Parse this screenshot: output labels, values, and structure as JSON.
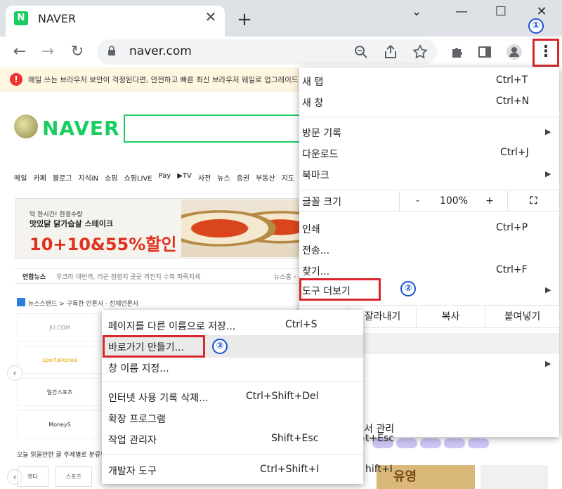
{
  "tab": {
    "title": "NAVER",
    "favicon_letter": "N",
    "close": "✕",
    "new_tab": "+"
  },
  "window": {
    "chevron": "⌄",
    "minimize": "—",
    "maximize": "☐",
    "close": "✕"
  },
  "toolbar": {
    "back": "←",
    "forward": "→",
    "reload": "↻",
    "url": "naver.com"
  },
  "page": {
    "banner": "매일 쓰는 브라우저 보안이 걱정된다면, 안전하고 빠른 최신 브라우저 웨일로 업그레이드 하세요",
    "banner_icon": "!",
    "logo": "NAVER",
    "nav_links": [
      "메일",
      "카페",
      "블로그",
      "지식iN",
      "쇼핑",
      "쇼핑LIVE",
      "Pay",
      "▶TV",
      "사전",
      "뉴스",
      "증권",
      "부동산",
      "지도"
    ],
    "ad": {
      "sub": "딱 한시간! 한정수량",
      "title": "맛있닭 닭가슴살 스테이크",
      "promo": "10+10&55%할인"
    },
    "news": {
      "source": "연합뉴스",
      "headline": "우크라 대반격, 러군 점령지 곳곳 격전지 수복 파죽지세",
      "buttons": "뉴스홈 ‹ ›"
    },
    "newsstand": "뉴스스탠드 > 구독한 언론사 · 전체언론사",
    "press": [
      "JU.COM",
      "sportalkorea",
      "일간스포츠",
      "MoneyS"
    ],
    "today": "오늘 읽을만한 글  주제별로 분류된 다양한 글 모음",
    "bottom_tabs": [
      "엔터",
      "스포츠"
    ],
    "left_arrow": "‹",
    "right_banner": "유영"
  },
  "menu": {
    "new_tab": "새 탭",
    "new_tab_shortcut": "Ctrl+T",
    "new_window": "새 창",
    "new_window_shortcut": "Ctrl+N",
    "history": "방문 기록",
    "downloads": "다운로드",
    "downloads_shortcut": "Ctrl+J",
    "bookmarks": "북마크",
    "zoom_label": "글꼴 크기",
    "zoom_minus": "-",
    "zoom_value": "100%",
    "zoom_plus": "+",
    "fullscreen": "⛶",
    "print": "인쇄",
    "print_shortcut": "Ctrl+P",
    "cast": "전송...",
    "find": "찾기...",
    "find_shortcut": "Ctrl+F",
    "more_tools": "도구 더보기",
    "cut": "잘라내기",
    "copy": "복사",
    "paste": "붙여넣기",
    "managed": "서 관리",
    "submenu_arrow": "▶"
  },
  "submenu": {
    "save_page": "페이지를 다른 이름으로 저장...",
    "save_page_shortcut": "Ctrl+S",
    "create_shortcut": "바로가기 만들기...",
    "name_window": "창 이름 지정...",
    "clear_data": "인터넷 사용 기록 삭제...",
    "clear_data_shortcut": "Ctrl+Shift+Del",
    "extensions": "확장 프로그램",
    "task_manager": "작업 관리자",
    "task_manager_shortcut": "Shift+Esc",
    "task_manager_shortcut_clip": "t+Esc",
    "dev_tools": "개발자 도구",
    "dev_tools_shortcut": "Ctrl+Shift+I",
    "dev_tools_shortcut_clip": "hift+I"
  },
  "callouts": [
    "①",
    "②",
    "③"
  ],
  "colors": {
    "naver_green": "#19ce60",
    "highlight_red": "#d8282b",
    "callout_blue": "#1a4fd0"
  }
}
